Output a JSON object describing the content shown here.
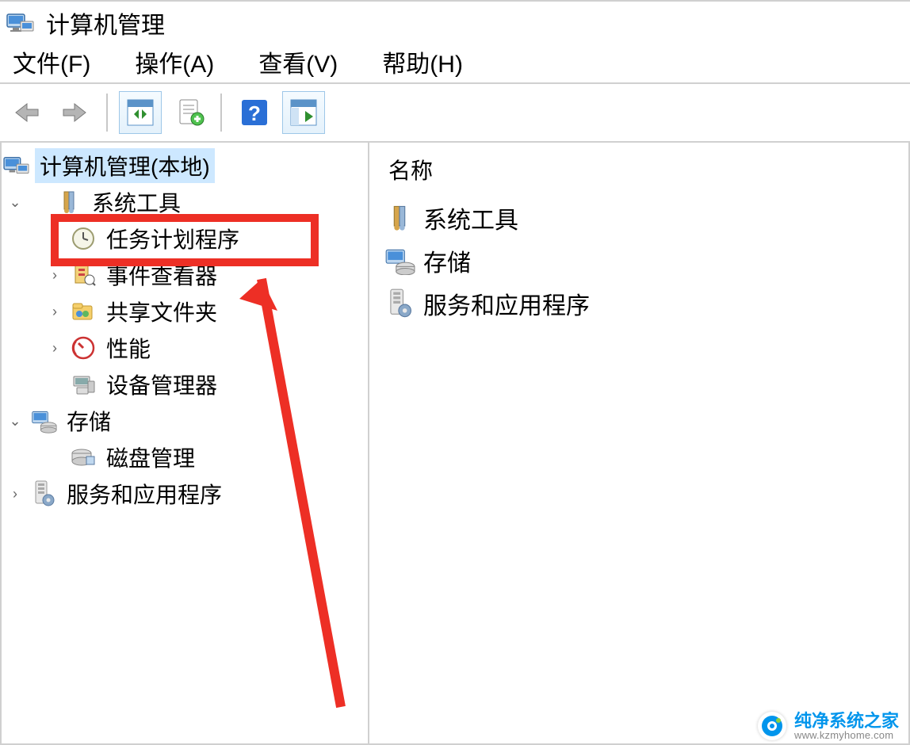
{
  "window": {
    "title": "计算机管理"
  },
  "menu": {
    "file": "文件(F)",
    "action": "操作(A)",
    "view": "查看(V)",
    "help": "帮助(H)"
  },
  "toolbar_icons": {
    "back": "back-arrow-icon",
    "forward": "forward-arrow-icon",
    "up": "panel-nav-icon",
    "props": "properties-icon",
    "help": "help-icon",
    "panes": "show-panes-icon"
  },
  "tree": {
    "root": {
      "label": "计算机管理(本地)"
    },
    "system_tools": {
      "label": "系统工具",
      "children": {
        "task_scheduler": "任务计划程序",
        "event_viewer": "事件查看器",
        "shared_folders": "共享文件夹",
        "performance": "性能",
        "device_manager": "设备管理器"
      }
    },
    "storage": {
      "label": "存储",
      "children": {
        "disk_mgmt": "磁盘管理"
      }
    },
    "services_apps": {
      "label": "服务和应用程序"
    }
  },
  "list": {
    "header": "名称",
    "items": {
      "0": "系统工具",
      "1": "存储",
      "2": "服务和应用程序"
    }
  },
  "watermark": {
    "brand": "纯净系统之家",
    "url": "www.kzmyhome.com"
  }
}
